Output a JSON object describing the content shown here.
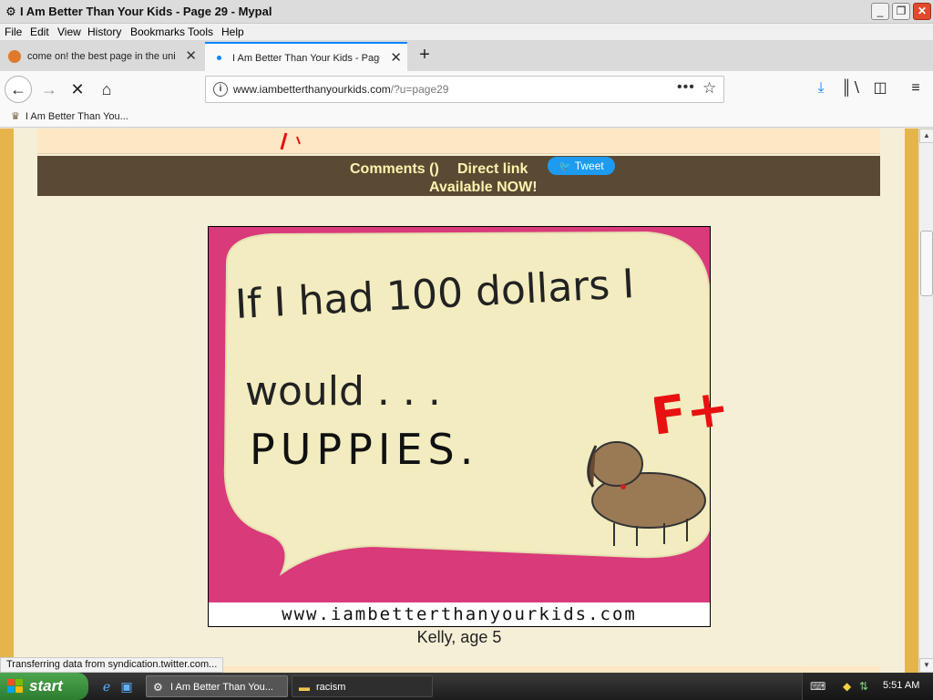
{
  "window": {
    "title": "I Am Better Than Your Kids - Page 29 - Mypal",
    "minimize": "_",
    "restore": "❐",
    "close": "✕"
  },
  "menu": [
    "File",
    "Edit",
    "View",
    "History",
    "Bookmarks",
    "Tools",
    "Help"
  ],
  "tabs": [
    {
      "label": "come on! the best page in the univ",
      "active": false
    },
    {
      "label": "I Am Better Than Your Kids - Page",
      "active": true
    }
  ],
  "tab_close": "✕",
  "new_tab": "+",
  "nav": {
    "url_host": "www.iambetterthanyourkids.com",
    "url_path": "/?u=page29",
    "page_actions": "•••"
  },
  "bookmarks": [
    {
      "label": "I Am Better Than You..."
    }
  ],
  "page": {
    "comments": "Comments ()",
    "direct_link": "Direct link",
    "tweet": "Tweet",
    "available": "Available NOW!",
    "drawing_text_line1": "If I had 100 dollars I",
    "drawing_text_line2": "would . . .",
    "drawing_text_line3": "PUPPIES.",
    "grade": "F+",
    "watermark": "www.iambetterthanyourkids.com",
    "caption": "Kelly, age 5"
  },
  "status": "Transferring data from syndication.twitter.com...",
  "taskbar": {
    "start": "start",
    "items": [
      {
        "label": "I Am Better Than You...",
        "active": true
      },
      {
        "label": "racism",
        "active": false
      }
    ],
    "clock": "5:51 AM"
  },
  "colors": {
    "page_outer": "#e5b54a",
    "column": "#f5efd7",
    "info_bar": "#5a4a33",
    "info_text": "#fff2b0",
    "tweet": "#1d9bf0",
    "drawing_pink": "#d83a7a",
    "paper": "#f2ecc0",
    "grade_red": "#e81010"
  },
  "icons": {
    "back": "back-arrow-icon",
    "forward": "forward-arrow-icon",
    "stop": "stop-icon",
    "home": "home-icon",
    "downloads": "download-icon",
    "library": "library-icon",
    "sidebar": "sidebar-icon",
    "menu": "hamburger-menu-icon"
  }
}
